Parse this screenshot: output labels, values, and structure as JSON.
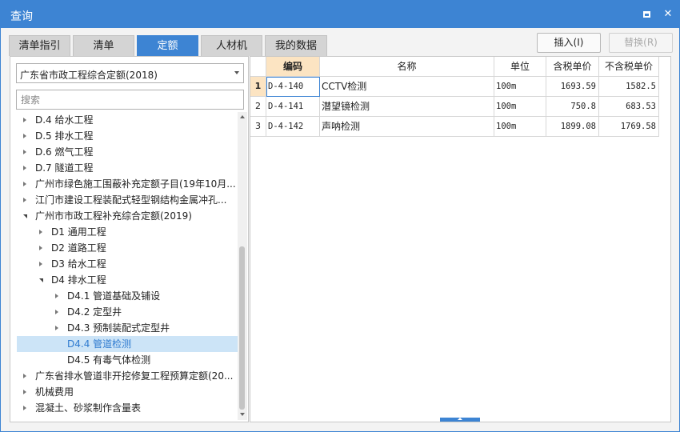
{
  "window": {
    "title": "查询"
  },
  "tabs": [
    {
      "label": "清单指引",
      "active": false
    },
    {
      "label": "清单",
      "active": false
    },
    {
      "label": "定额",
      "active": true
    },
    {
      "label": "人材机",
      "active": false
    },
    {
      "label": "我的数据",
      "active": false
    }
  ],
  "toolbar": {
    "insert_label": "插入(I)",
    "replace_label": "替换(R)"
  },
  "left": {
    "combo_value": "广东省市政工程综合定额(2018)",
    "search_placeholder": "搜索",
    "tree": [
      {
        "label": "D.4 给水工程",
        "level": 0,
        "state": "closed"
      },
      {
        "label": "D.5 排水工程",
        "level": 0,
        "state": "closed"
      },
      {
        "label": "D.6 燃气工程",
        "level": 0,
        "state": "closed"
      },
      {
        "label": "D.7 隧道工程",
        "level": 0,
        "state": "closed"
      },
      {
        "label": "广州市绿色施工围蔽补充定额子目(19年10月...",
        "level": 0,
        "state": "closed"
      },
      {
        "label": "江门市建设工程装配式轻型钢结构金属冲孔...",
        "level": 0,
        "state": "closed"
      },
      {
        "label": "广州市市政工程补充综合定额(2019)",
        "level": 0,
        "state": "open"
      },
      {
        "label": "D1 通用工程",
        "level": 1,
        "state": "closed"
      },
      {
        "label": "D2 道路工程",
        "level": 1,
        "state": "closed"
      },
      {
        "label": "D3 给水工程",
        "level": 1,
        "state": "closed"
      },
      {
        "label": "D4 排水工程",
        "level": 1,
        "state": "open"
      },
      {
        "label": "D4.1 管道基础及铺设",
        "level": 2,
        "state": "closed"
      },
      {
        "label": "D4.2 定型井",
        "level": 2,
        "state": "closed"
      },
      {
        "label": "D4.3 预制装配式定型井",
        "level": 2,
        "state": "closed"
      },
      {
        "label": "D4.4 管道检测",
        "level": 2,
        "state": "leaf",
        "selected": true
      },
      {
        "label": "D4.5 有毒气体检测",
        "level": 2,
        "state": "leaf"
      },
      {
        "label": "广东省排水管道非开挖修复工程预算定额(20...",
        "level": 0,
        "state": "closed"
      },
      {
        "label": "机械费用",
        "level": 0,
        "state": "closed"
      },
      {
        "label": "混凝土、砂浆制作含量表",
        "level": 0,
        "state": "closed"
      }
    ]
  },
  "grid": {
    "headers": [
      "",
      "编码",
      "名称",
      "单位",
      "含税单价",
      "不含税单价"
    ],
    "rows": [
      {
        "num": "1",
        "code": "D-4-140",
        "name": "CCTV检测",
        "unit": "100m",
        "price_tax": "1693.59",
        "price_notax": "1582.5"
      },
      {
        "num": "2",
        "code": "D-4-141",
        "name": "潜望镜检测",
        "unit": "100m",
        "price_tax": "750.8",
        "price_notax": "683.53"
      },
      {
        "num": "3",
        "code": "D-4-142",
        "name": "声呐检测",
        "unit": "100m",
        "price_tax": "1899.08",
        "price_notax": "1769.58"
      }
    ]
  }
}
